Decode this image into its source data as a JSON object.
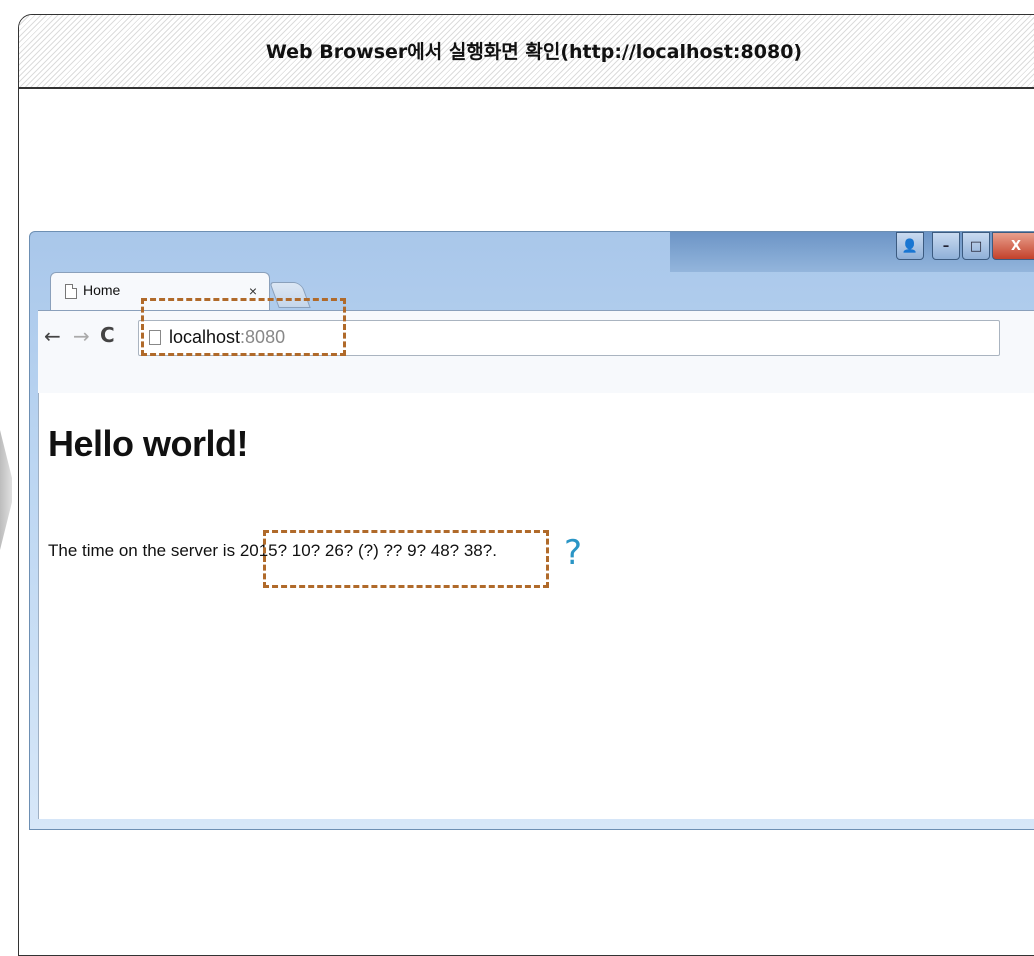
{
  "slide": {
    "title": "Web Browser에서 실행화면 확인(http://localhost:8080)"
  },
  "browser": {
    "tab": {
      "label": "Home",
      "close": "×"
    },
    "window_controls": {
      "user": "👤",
      "minimize": "–",
      "maximize": "□",
      "close": "X"
    },
    "toolbar": {
      "back": "←",
      "forward": "→",
      "reload": "C",
      "address_host": "localhost",
      "address_port": ":8080",
      "star": "☆",
      "menu": "≡"
    },
    "page": {
      "heading": "Hello world!",
      "text_prefix": "The time on the server is ",
      "server_time": "2015? 10? 26? (?) ?? 9? 48? 38?."
    }
  },
  "annotations": {
    "question_mark": "?",
    "highlight_color": "#b06a2a",
    "question_color": "#2a95c5"
  }
}
